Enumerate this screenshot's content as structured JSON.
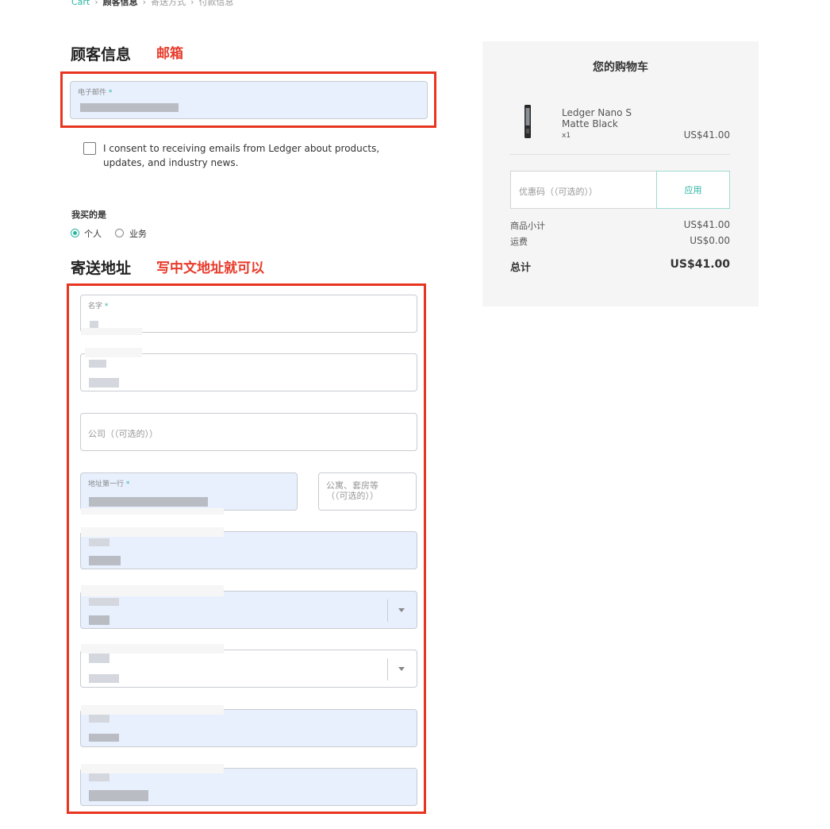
{
  "breadcrumb": {
    "items": [
      "Cart",
      "顾客信息",
      "寄送方式",
      "付款信息"
    ],
    "separator": "›"
  },
  "customer": {
    "heading": "顾客信息",
    "annotation": "邮箱",
    "email_label": "电子邮件",
    "required_mark": "*",
    "consent_text_line1": "I consent to receiving emails from Ledger about products,",
    "consent_text_line2": "updates, and industry news.",
    "buying_as_label": "我买的是",
    "options": [
      "个人",
      "业务"
    ],
    "selected_option": "个人"
  },
  "shipping": {
    "heading": "寄送地址",
    "annotation": "写中文地址就可以",
    "first_name_label": "名字",
    "company_placeholder": "公司（（可选的））",
    "address1_label": "地址第一行",
    "apartment_placeholder_line1": "公寓、套房等",
    "apartment_placeholder_line2": "（（可选的））"
  },
  "cart": {
    "title": "您的购物车",
    "product_name_line1": "Ledger Nano S",
    "product_name_line2": "Matte Black",
    "quantity": "x1",
    "product_price": "US$41.00",
    "coupon_placeholder": "优惠码（（可选的））",
    "apply_label": "应用",
    "subtotal_label": "商品小计",
    "subtotal_value": "US$41.00",
    "shipping_label": "运费",
    "shipping_value": "US$0.00",
    "total_label": "总计",
    "total_value": "US$41.00"
  },
  "colors": {
    "accent": "#2bb5a0",
    "annotation_red": "#e8351f",
    "filled_field": "#e8f0fe",
    "cart_bg": "#f5f5f5"
  }
}
